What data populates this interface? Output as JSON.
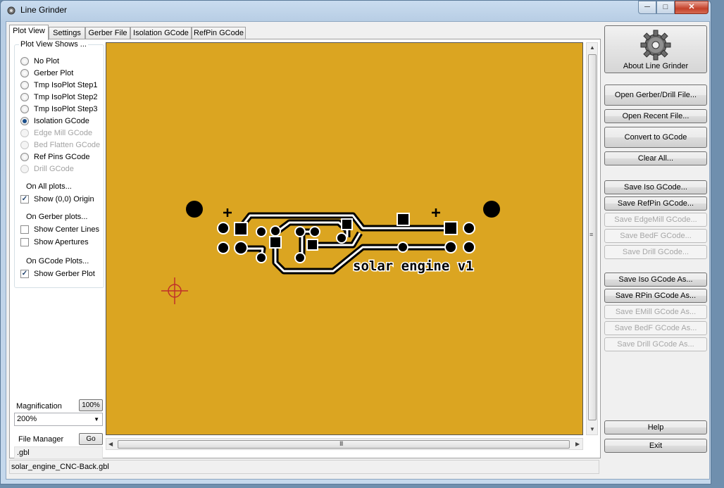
{
  "window": {
    "title": "Line Grinder",
    "controls": {
      "minimize": "─",
      "maximize": "□",
      "close": "✕"
    }
  },
  "tabs": [
    "Plot View",
    "Settings",
    "Gerber File",
    "Isolation GCode",
    "RefPin GCode"
  ],
  "plot_view_shows": {
    "title": "Plot View Shows ...",
    "options": [
      {
        "label": "No Plot",
        "selected": false,
        "enabled": true
      },
      {
        "label": "Gerber Plot",
        "selected": false,
        "enabled": true
      },
      {
        "label": "Tmp IsoPlot Step1",
        "selected": false,
        "enabled": true
      },
      {
        "label": "Tmp IsoPlot Step2",
        "selected": false,
        "enabled": true
      },
      {
        "label": "Tmp IsoPlot Step3",
        "selected": false,
        "enabled": true
      },
      {
        "label": "Isolation GCode",
        "selected": true,
        "enabled": true
      },
      {
        "label": "Edge Mill GCode",
        "selected": false,
        "enabled": false
      },
      {
        "label": "Bed Flatten GCode",
        "selected": false,
        "enabled": false
      },
      {
        "label": "Ref Pins GCode",
        "selected": false,
        "enabled": true
      },
      {
        "label": "Drill GCode",
        "selected": false,
        "enabled": false
      }
    ],
    "on_all_plots": "On All plots...",
    "show_origin": {
      "label": "Show (0,0) Origin",
      "checked": true
    },
    "on_gerber_plots": "On Gerber plots...",
    "show_center_lines": {
      "label": "Show Center Lines",
      "checked": false
    },
    "show_apertures": {
      "label": "Show Apertures",
      "checked": false
    },
    "on_gcode_plots": "On GCode Plots...",
    "show_gerber_plot": {
      "label": "Show Gerber Plot",
      "checked": true
    }
  },
  "magnification": {
    "label": "Magnification",
    "reset_button": "100%",
    "value": "200%"
  },
  "file_manager": {
    "label": "File Manager",
    "go_button": "Go",
    "value": ".gbl"
  },
  "plot": {
    "board_text": "solar engine v1",
    "background": "#dba521",
    "origin_marker_color": "#c0302a"
  },
  "status": {
    "filename": "solar_engine_CNC-Back.gbl"
  },
  "right_panel": {
    "about": "About Line Grinder",
    "buttons": [
      {
        "label": "Open Gerber/Drill File...",
        "enabled": true
      },
      {
        "label": "Open Recent File...",
        "enabled": true
      },
      {
        "label": "Convert to GCode",
        "enabled": true
      },
      {
        "label": "Clear All...",
        "enabled": true
      },
      {
        "label": "Save Iso GCode...",
        "enabled": true
      },
      {
        "label": "Save RefPin GCode...",
        "enabled": true
      },
      {
        "label": "Save EdgeMill GCode...",
        "enabled": false
      },
      {
        "label": "Save BedF GCode...",
        "enabled": false
      },
      {
        "label": "Save Drill GCode...",
        "enabled": false
      },
      {
        "label": "Save Iso GCode As...",
        "enabled": true
      },
      {
        "label": "Save RPin GCode As...",
        "enabled": true
      },
      {
        "label": "Save EMill GCode As...",
        "enabled": false
      },
      {
        "label": "Save BedF GCode As...",
        "enabled": false
      },
      {
        "label": "Save Drill GCode As...",
        "enabled": false
      },
      {
        "label": "Help",
        "enabled": true
      },
      {
        "label": "Exit",
        "enabled": true
      }
    ]
  }
}
